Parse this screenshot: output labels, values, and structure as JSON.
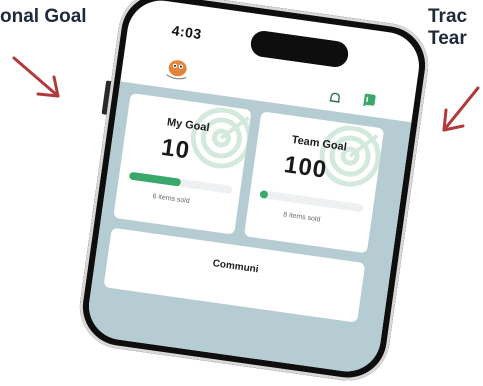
{
  "captions": {
    "left": "onal Goal",
    "right_line1": "Trac",
    "right_line2": "Tear"
  },
  "status_bar": {
    "time": "4:03"
  },
  "cards": {
    "my_goal": {
      "label": "My Goal",
      "value": "10",
      "progress": 0.5,
      "sub": "6 items sold"
    },
    "team_goal": {
      "label": "Team Goal",
      "value": "100",
      "progress": 0.08,
      "sub": "8 items sold"
    },
    "community": {
      "label": "Communi"
    }
  },
  "icons": {
    "logo": "mascot-logo-icon",
    "bell": "bell-icon",
    "chat": "chat-icon",
    "target": "target-icon",
    "arrow": "arrow-down-icon"
  },
  "colors": {
    "accent_green": "#3aa86a",
    "panel_bg": "#b5cdd2",
    "arrow_red": "#b23a3a",
    "caption_text": "#1e2a3a"
  }
}
